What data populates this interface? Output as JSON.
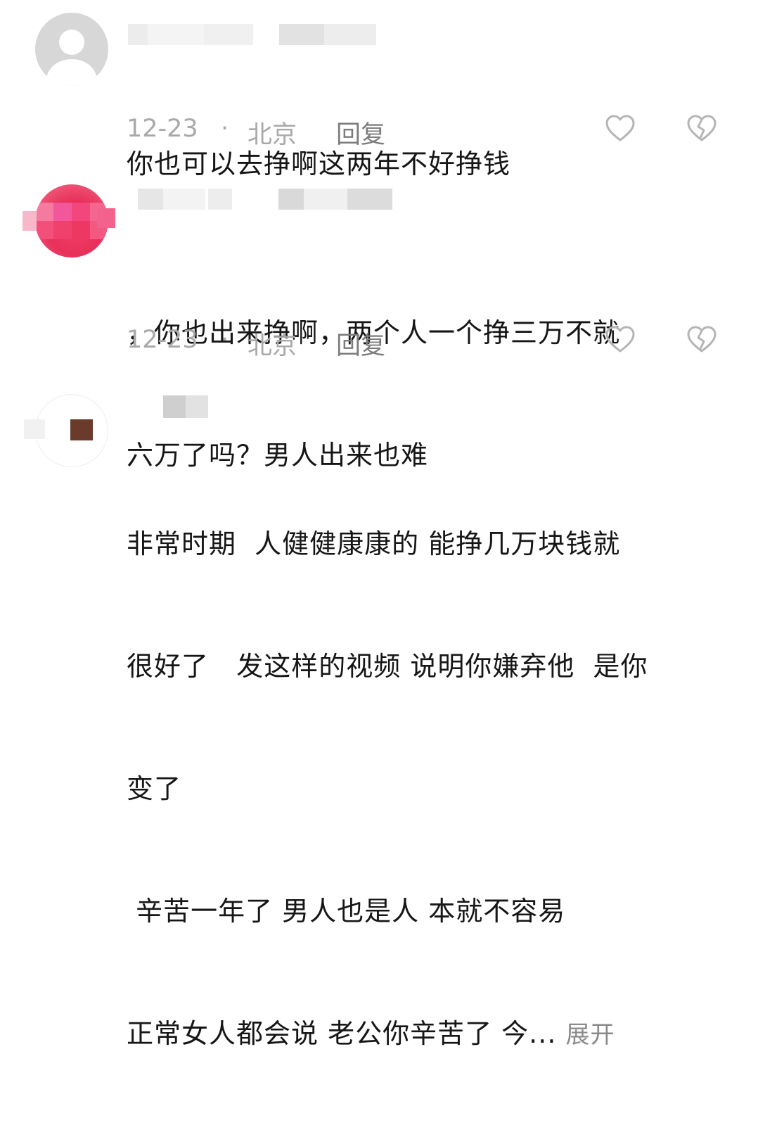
{
  "comments": [
    {
      "text_lines": [
        "你也可以去挣啊这两年不好挣钱"
      ],
      "date": "12-23",
      "separator": "·",
      "location": "北京",
      "reply_label": "回复",
      "like_icon": "heart-outline-icon",
      "dislike_icon": "broken-heart-icon"
    },
    {
      "text_lines": [
        "，你也出来挣啊，两个人一个挣三万不就",
        "六万了吗？男人出来也难"
      ],
      "date": "12-23",
      "separator": "·",
      "location": "北京",
      "reply_label": "回复",
      "like_icon": "heart-outline-icon",
      "dislike_icon": "broken-heart-icon"
    },
    {
      "text_lines": [
        "非常时期  人健健康康的 能挣几万块钱就",
        "很好了   发这样的视频 说明你嫌弃他  是你",
        "变了",
        " 辛苦一年了 男人也是人 本就不容易",
        "正常女人都会说 老公你辛苦了 今..."
      ],
      "expand_label": "展开"
    }
  ],
  "colors": {
    "text": "#161616",
    "meta": "#a9a9a9",
    "reply": "#7c7c7c",
    "icon": "#b5b5b5"
  }
}
